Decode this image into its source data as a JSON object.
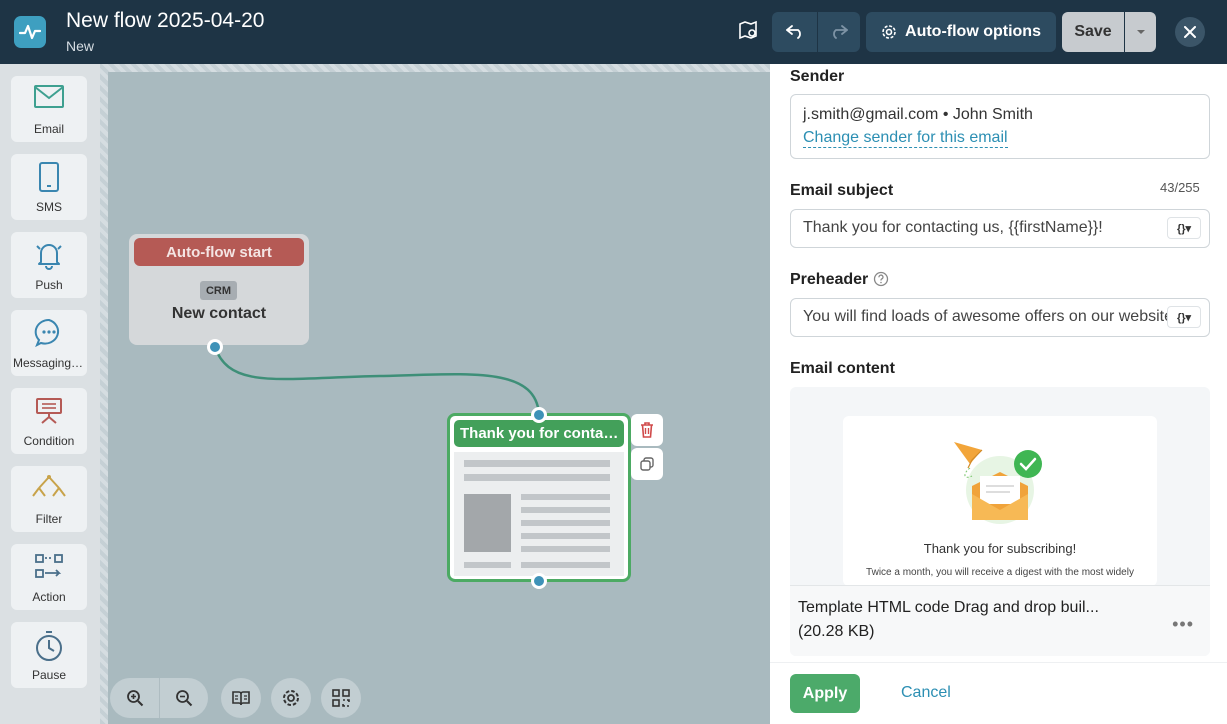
{
  "header": {
    "title": "New flow 2025-04-20",
    "status": "New",
    "auto_flow_options": "Auto-flow options",
    "save": "Save"
  },
  "sidebar": {
    "items": [
      {
        "label": "Email",
        "icon": "envelope-icon"
      },
      {
        "label": "SMS",
        "icon": "phone-icon"
      },
      {
        "label": "Push",
        "icon": "bell-icon"
      },
      {
        "label": "Messaging apps",
        "icon": "chat-bubble-icon"
      },
      {
        "label": "Condition",
        "icon": "condition-icon"
      },
      {
        "label": "Filter",
        "icon": "filter-icon"
      },
      {
        "label": "Action",
        "icon": "action-icon"
      },
      {
        "label": "Pause",
        "icon": "stopwatch-icon"
      }
    ]
  },
  "canvas": {
    "start_node": {
      "header": "Auto-flow start",
      "badge": "CRM",
      "label": "New contact"
    },
    "email_node": {
      "header": "Thank you for contacting us"
    }
  },
  "panel": {
    "sender_label": "Sender",
    "sender_value": "j.smith@gmail.com • John Smith",
    "sender_link": "Change sender for this email",
    "subject_label": "Email subject",
    "subject_counter": "43/255",
    "subject_value": "Thank you for contacting us, {{firstName}}!",
    "preheader_label": "Preheader",
    "preheader_value": "You will find loads of awesome offers on our website",
    "content_label": "Email content",
    "preview_title": "Thank you for subscribing!",
    "preview_text": "Twice a month, you will receive a digest with the most widely",
    "template_name": "Template HTML code Drag and drop buil...",
    "template_size": "(20.28 KB)",
    "apply": "Apply",
    "cancel": "Cancel"
  },
  "colors": {
    "topbar": "#1e3445",
    "accent_green": "#4caa6a",
    "link_blue": "#2c8fb3",
    "start_red": "#b55a55"
  }
}
